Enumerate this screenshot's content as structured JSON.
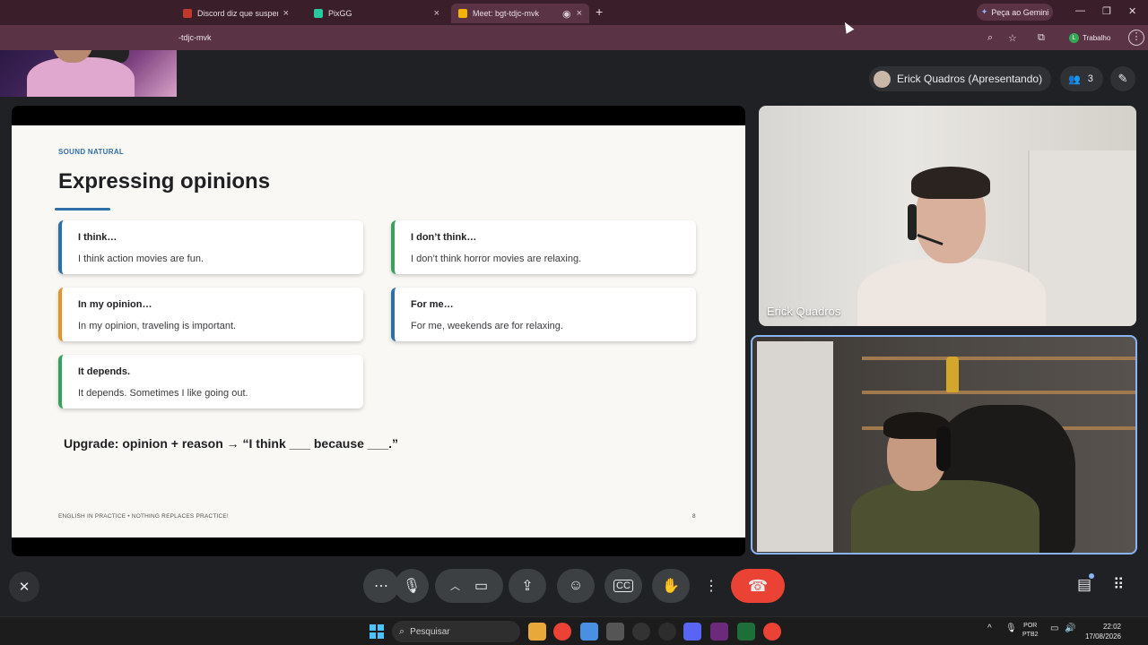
{
  "browser": {
    "tabs": [
      {
        "title": "Discord diz que suspendeu live",
        "icon": "discord-icon",
        "color": "#c0392b"
      },
      {
        "title": "PixGG",
        "icon": "pixgg-icon",
        "color": "#28c9a0"
      },
      {
        "title": "Meet: bgt-tdjc-mvk",
        "icon": "meet-icon",
        "color": "#f4b400"
      }
    ],
    "gemini_label": "Peça ao Gemini",
    "url": "-tdjc-mvk",
    "profile": "Trabalho",
    "profile_initial": "L"
  },
  "meet": {
    "presenter_label": "Erick Quadros (Apresentando)",
    "participant_count": "3",
    "participants": [
      {
        "name": "Erick Quadros"
      }
    ]
  },
  "slide": {
    "eyebrow": "SOUND NATURAL",
    "title": "Expressing opinions",
    "cards": [
      {
        "heading": "I think…",
        "example": "I think action movies are fun.",
        "color": "#2f6fa8"
      },
      {
        "heading": "I don’t think…",
        "example": "I don’t think horror movies are relaxing.",
        "color": "#3aa15a"
      },
      {
        "heading": "In my opinion…",
        "example": "In my opinion, traveling is important.",
        "color": "#e0962d"
      },
      {
        "heading": "For me…",
        "example": "For me, weekends are for relaxing.",
        "color": "#2f6fa8"
      },
      {
        "heading": "It depends.",
        "example": "It depends. Sometimes I like going out.",
        "color": "#3aa15a"
      }
    ],
    "upgrade": "Upgrade: opinion + reason → “I think ___ because ___.”",
    "footer": "ENGLISH IN PRACTICE  •  NOTHING REPLACES PRACTICE!",
    "page": "8"
  },
  "taskbar": {
    "search_placeholder": "Pesquisar",
    "language": "POR",
    "keyboard": "PTB2",
    "time": "22:02",
    "date": "17/08/2026"
  }
}
